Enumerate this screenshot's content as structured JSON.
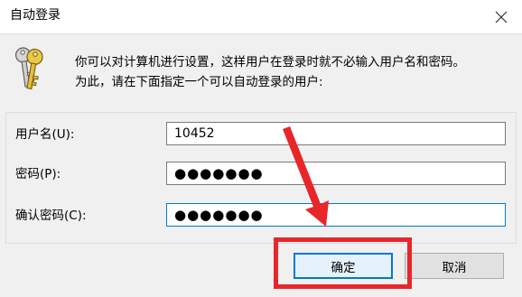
{
  "window": {
    "title": "自动登录",
    "close_icon": "close-icon"
  },
  "description": {
    "line1": "你可以对计算机进行设置，这样用户在登录时就不必输入用户名和密码。",
    "line2": "为此，请在下面指定一个可以自动登录的用户:",
    "icon": "keys-icon"
  },
  "form": {
    "username_label": "用户名(U):",
    "username_value": "10452",
    "password_label": "密码(P):",
    "password_value": "●●●●●●●",
    "confirm_label": "确认密码(C):",
    "confirm_value": "●●●●●●●"
  },
  "buttons": {
    "ok": "确定",
    "cancel": "取消"
  },
  "annotation": {
    "color": "#e8262a",
    "icons": [
      "highlight-box",
      "arrow-icon"
    ]
  }
}
